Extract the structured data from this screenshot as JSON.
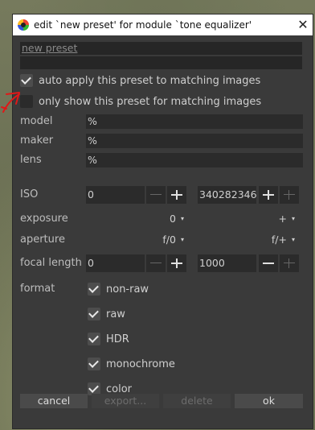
{
  "dialog": {
    "title": "edit `new preset' for module `tone equalizer'",
    "close_glyph": "✕"
  },
  "preset": {
    "name": "new preset",
    "description": "",
    "auto_apply": {
      "label": "auto apply this preset to matching images",
      "checked": true
    },
    "only_show": {
      "label": "only show this preset for matching images",
      "checked": false
    }
  },
  "filters": {
    "model": {
      "label": "model",
      "value": "%"
    },
    "maker": {
      "label": "maker",
      "value": "%"
    },
    "lens": {
      "label": "lens",
      "value": "%"
    },
    "iso": {
      "label": "ISO",
      "min": "0",
      "max": "340282346"
    },
    "exposure": {
      "label": "exposure",
      "min": "0",
      "max": "+"
    },
    "aperture": {
      "label": "aperture",
      "min": "f/0",
      "max": "f/+"
    },
    "focal_length": {
      "label": "focal length",
      "min": "0",
      "max": "1000"
    },
    "format": {
      "label": "format",
      "options": [
        {
          "label": "non-raw",
          "checked": true
        },
        {
          "label": "raw",
          "checked": true
        },
        {
          "label": "HDR",
          "checked": true
        },
        {
          "label": "monochrome",
          "checked": true
        },
        {
          "label": "color",
          "checked": true
        }
      ]
    }
  },
  "buttons": {
    "cancel": "cancel",
    "export": "export...",
    "delete": "delete",
    "ok": "ok"
  },
  "colors": {
    "dialog_bg": "#3a3a3a",
    "field_bg": "#2b2b2b",
    "annotation": "#e01818"
  },
  "dropdown_glyph": "▾"
}
